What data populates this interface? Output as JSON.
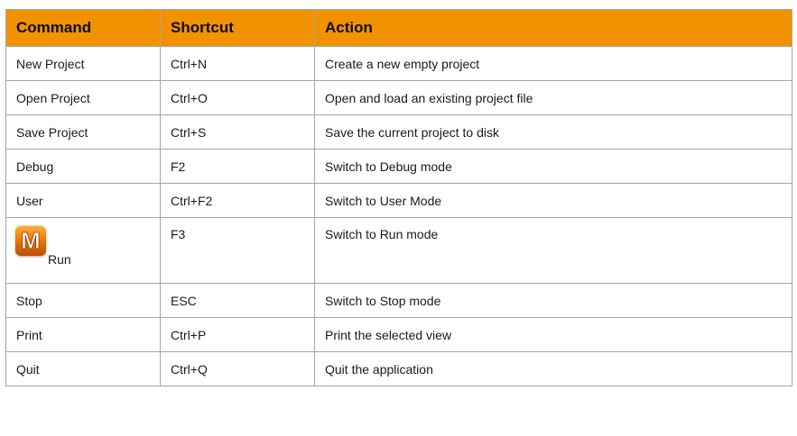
{
  "headers": {
    "command": "Command",
    "shortcut": "Shortcut",
    "action": "Action"
  },
  "rows": [
    {
      "command": "New Project",
      "shortcut": "Ctrl+N",
      "action": "Create a new empty project"
    },
    {
      "command": "Open Project",
      "shortcut": "Ctrl+O",
      "action": "Open and load an existing project file"
    },
    {
      "command": "Save Project",
      "shortcut": "Ctrl+S",
      "action": "Save the current project to disk"
    },
    {
      "command": "Debug",
      "shortcut": "F2",
      "action": "Switch to Debug mode"
    },
    {
      "command": "User",
      "shortcut": "Ctrl+F2",
      "action": "Switch to User Mode"
    },
    {
      "command": "Run",
      "icon": "m-logo-icon",
      "icon_letter": "M",
      "shortcut": "F3",
      "action": "Switch to Run mode"
    },
    {
      "command": "Stop",
      "shortcut": "ESC",
      "action": "Switch to Stop mode"
    },
    {
      "command": "Print",
      "shortcut": "Ctrl+P",
      "action": "Print the selected view"
    },
    {
      "command": "Quit",
      "shortcut": "Ctrl+Q",
      "action": "Quit the application"
    }
  ],
  "colors": {
    "header_background": "#f29200",
    "border": "#a6a6a6"
  }
}
